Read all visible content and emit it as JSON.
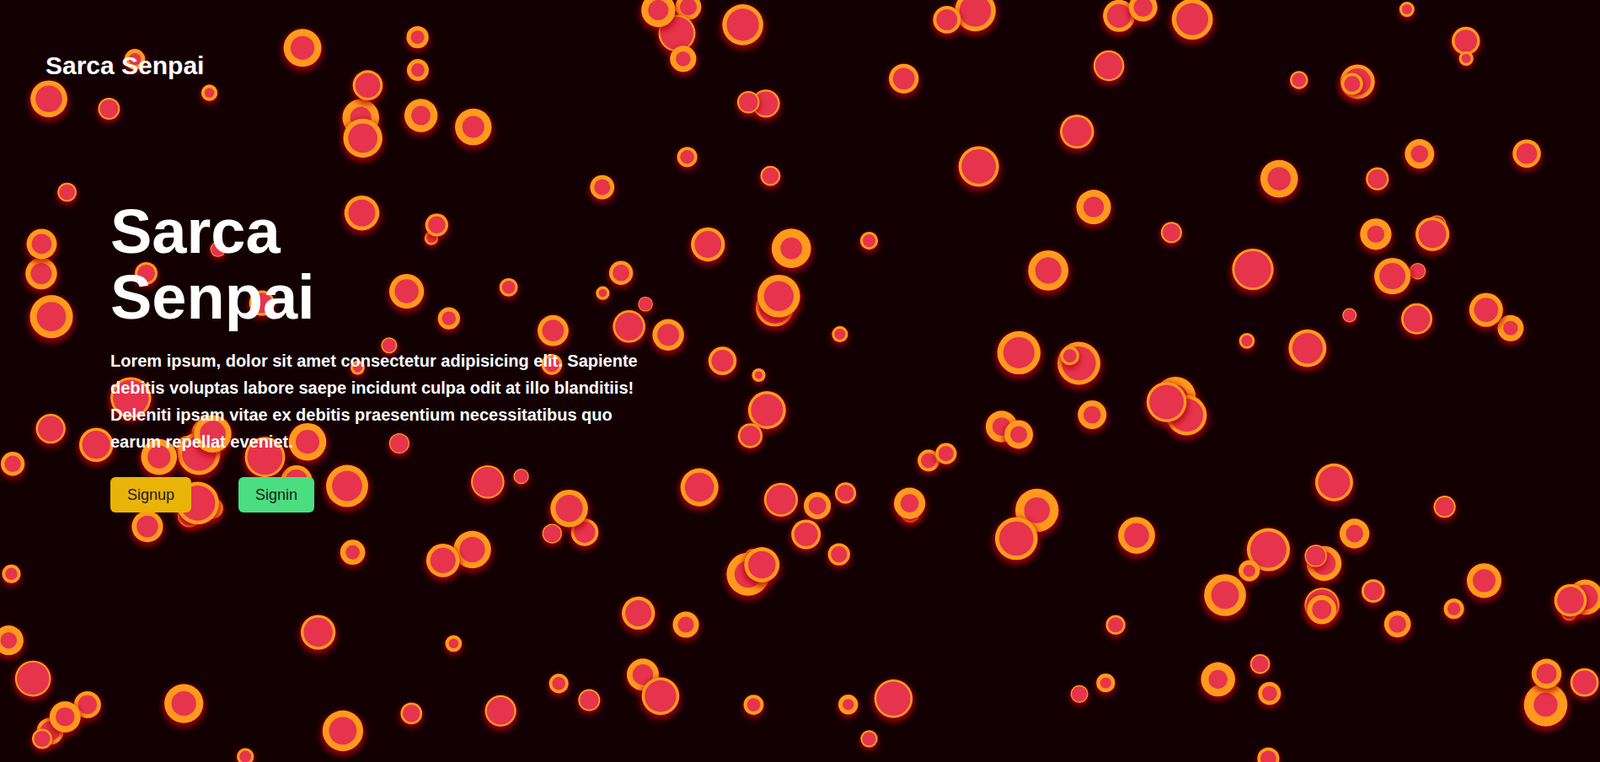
{
  "nav": {
    "logo": "Sarca Senpai"
  },
  "hero": {
    "title": "Sarca Senpai",
    "text": "Lorem ipsum, dolor sit amet consectetur adipisicing elit. Sapiente debitis voluptas labore saepe incidunt culpa odit at illo blanditiis! Deleniti ipsam vitae ex debitis praesentium necessitatibus quo earum repellat eveniet.",
    "buttons": [
      {
        "label": "Signup",
        "color": "#eab308"
      },
      {
        "label": "Signin",
        "color": "#4ade80"
      }
    ]
  }
}
